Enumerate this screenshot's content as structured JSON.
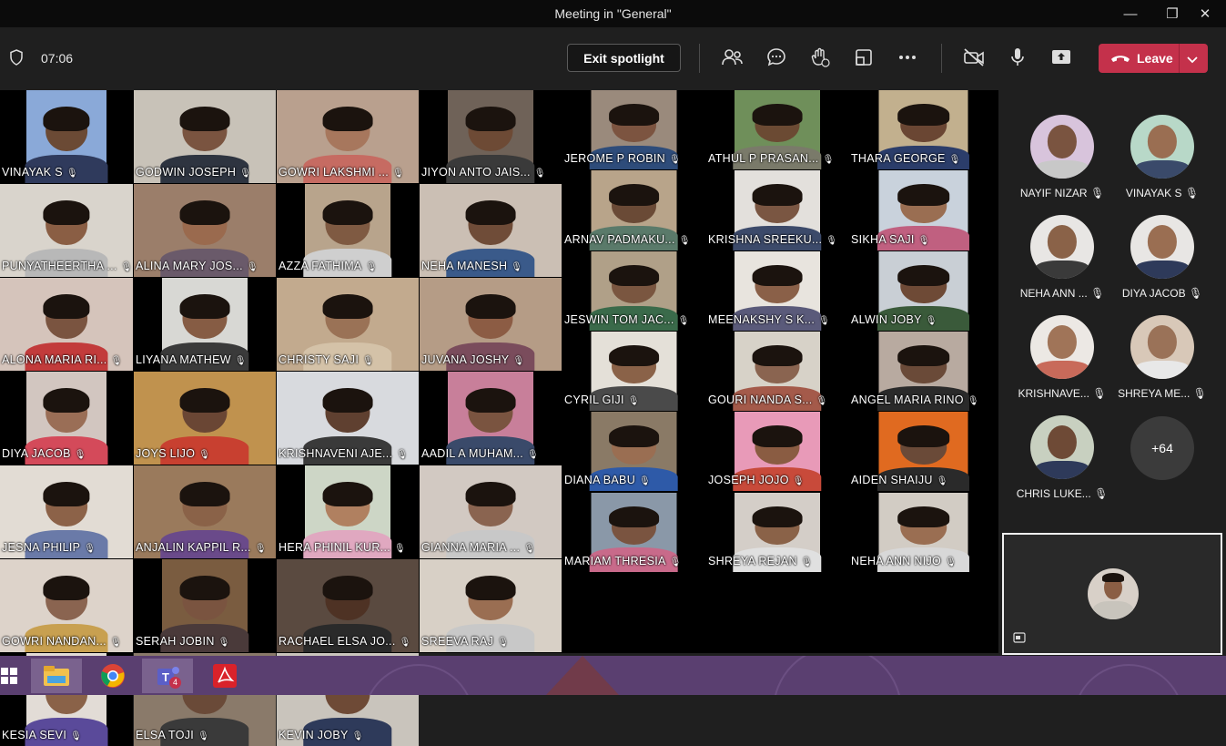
{
  "window": {
    "title": "Meeting in \"General\"",
    "minimize": "—",
    "maximize": "❐",
    "close": "✕"
  },
  "toolbar": {
    "timer": "07:06",
    "exit_spotlight": "Exit spotlight",
    "leave_label": "Leave",
    "icons": [
      "shield-icon",
      "participants-icon",
      "chat-icon",
      "raise-hand-icon",
      "share-tray-icon",
      "more-icon",
      "camera-off-icon",
      "mic-icon",
      "share-screen-icon",
      "phone-icon",
      "chevron-down-icon"
    ]
  },
  "colors": {
    "leave": "#c4314b",
    "bg": "#1f1f1f",
    "titlebar": "#0b0b0b",
    "taskbar": "#5a3f70"
  },
  "grid": {
    "tiles": [
      {
        "name": "VINAYAK  S",
        "bg": "#8aa9d8",
        "skin": "#6b4a35",
        "shirt": "#2f3a5c"
      },
      {
        "name": "GODWIN JOSEPH",
        "bg": "#c8c2b8",
        "skin": "#7a5440",
        "shirt": "#2e3440"
      },
      {
        "name": "GOWRI  LAKSHMI ...",
        "bg": "#b9a08e",
        "skin": "#a7775d",
        "shirt": "#c66b62"
      },
      {
        "name": "JIYON  ANTO JAIS...",
        "bg": "#6f6258",
        "skin": "#6d4a35",
        "shirt": "#3a3a3a"
      },
      {
        "name": "JEROME  P ROBIN",
        "bg": "#9a8a7c",
        "skin": "#7c5440",
        "shirt": "#2e4c7a"
      },
      {
        "name": "ATHUL  P PRASAN...",
        "bg": "#6f8f5a",
        "skin": "#6b4a33",
        "shirt": "#7a7a6a"
      },
      {
        "name": "THARA GEORGE",
        "bg": "#c2b08e",
        "skin": "#6a4633",
        "shirt": "#2b3d6a"
      },
      {
        "name": "PUNYATHEERTHA ...",
        "bg": "#d9d4cc",
        "skin": "#8a5e44",
        "shirt": "#b8b8b8"
      },
      {
        "name": "ALINA  MARY JOS...",
        "bg": "#9b7e6a",
        "skin": "#9a6a4e",
        "shirt": "#6a5a6a"
      },
      {
        "name": "AZZA  FATHIMA",
        "bg": "#b8a48c",
        "skin": "#7f5a42",
        "shirt": "#cfcfcf"
      },
      {
        "name": "NEHA  MANESH",
        "bg": "#cbbfb4",
        "skin": "#6f4c38",
        "shirt": "#3a5a8a"
      },
      {
        "name": "ARNAV PADMAKU...",
        "bg": "#b8a48a",
        "skin": "#6a4a36",
        "shirt": "#5a7a6a"
      },
      {
        "name": "KRISHNA  SREEKU...",
        "bg": "#e3e0dc",
        "skin": "#7a5642",
        "shirt": "#3c4a6a"
      },
      {
        "name": "SIKHA  SAJI",
        "bg": "#c9d2dc",
        "skin": "#9a6e52",
        "shirt": "#c06080"
      },
      {
        "name": "ALONA  MARIA RI...",
        "bg": "#d5c4bb",
        "skin": "#7a5440",
        "shirt": "#c23b3b"
      },
      {
        "name": "LIYANA  MATHEW",
        "bg": "#d8d8d4",
        "skin": "#865c44",
        "shirt": "#3a3a3a"
      },
      {
        "name": "CHRISTY  SAJI",
        "bg": "#c2aa8e",
        "skin": "#9a7256",
        "shirt": "#d4c2a8"
      },
      {
        "name": "JUVANA  JOSHY",
        "bg": "#b59c86",
        "skin": "#8c5c44",
        "shirt": "#7a4c5c"
      },
      {
        "name": "JESWIN  TOM JAC...",
        "bg": "#b0a088",
        "skin": "#7a5640",
        "shirt": "#3a6a4a"
      },
      {
        "name": "MEENAKSHY  S K...",
        "bg": "#e8e4de",
        "skin": "#8a6048",
        "shirt": "#5a5a7a"
      },
      {
        "name": "ALWIN  JOBY",
        "bg": "#c9cfd5",
        "skin": "#6e4a36",
        "shirt": "#3a5a3a"
      },
      {
        "name": "DIYA  JACOB",
        "bg": "#d2c6c0",
        "skin": "#9a6e56",
        "shirt": "#d44a5a"
      },
      {
        "name": "JOYS  LIJO",
        "bg": "#c0924e",
        "skin": "#6a4634",
        "shirt": "#c84030"
      },
      {
        "name": "KRISHNAVENI AJE...",
        "bg": "#d8dade",
        "skin": "#5f4030",
        "shirt": "#3a3a3a"
      },
      {
        "name": "AADIL  A MUHAM...",
        "bg": "#c87f9a",
        "skin": "#7a5440",
        "shirt": "#3a4a6a"
      },
      {
        "name": "CYRIL  GIJI",
        "bg": "#e4e0d8",
        "skin": "#8a6248",
        "shirt": "#4a4a4a"
      },
      {
        "name": "GOURI  NANDA S...",
        "bg": "#d7d2c8",
        "skin": "#8a6450",
        "shirt": "#a45a4a"
      },
      {
        "name": "ANGEL MARIA RINO",
        "bg": "#b8aaa0",
        "skin": "#6a4a38",
        "shirt": "#2a2a2a"
      },
      {
        "name": "JESNA  PHILIP",
        "bg": "#e2dcd4",
        "skin": "#8c6248",
        "shirt": "#6a7aa8"
      },
      {
        "name": "ANJALIN KAPPIL R...",
        "bg": "#9a7a5c",
        "skin": "#8a6248",
        "shirt": "#6a4a8a"
      },
      {
        "name": "HERA  PHINIL KUR...",
        "bg": "#cdd6c6",
        "skin": "#b08060",
        "shirt": "#e0a8c0"
      },
      {
        "name": "GIANNA  MARIA ...",
        "bg": "#d2c9c2",
        "skin": "#8a6450",
        "shirt": "#c8c8c8"
      },
      {
        "name": "DIANA  BABU",
        "bg": "#8a7a66",
        "skin": "#9a6e52",
        "shirt": "#2e5aa8"
      },
      {
        "name": "JOSEPH  JOJO",
        "bg": "#e89ab8",
        "skin": "#8a5c42",
        "shirt": "#c84a3a"
      },
      {
        "name": "AIDEN  SHAIJU",
        "bg": "#e06a20",
        "skin": "#6a4a38",
        "shirt": "#2a2a2a"
      },
      {
        "name": "GOWRI NANDAN...",
        "bg": "#ddd3ca",
        "skin": "#8a6450",
        "shirt": "#c8a050"
      },
      {
        "name": "SERAH  JOBIN",
        "bg": "#7a5c40",
        "skin": "#7a5440",
        "shirt": "#4a3a3a"
      },
      {
        "name": "RACHAEL  ELSA JO...",
        "bg": "#5a4a40",
        "skin": "#4e3224",
        "shirt": "#2a2a2a"
      },
      {
        "name": "SREEVA  RAJ",
        "bg": "#d8d0c6",
        "skin": "#9a6e52",
        "shirt": "#c8c8c8"
      },
      {
        "name": "MARIAM THRESIA",
        "bg": "#8a98a8",
        "skin": "#7a5440",
        "shirt": "#c86a8a"
      },
      {
        "name": "SHREYA  REJAN",
        "bg": "#d4cec8",
        "skin": "#8a6248",
        "shirt": "#e0e0e0"
      },
      {
        "name": "NEHA ANN NIJO",
        "bg": "#d2ccc4",
        "skin": "#9a6e52",
        "shirt": "#d8d8d8"
      },
      {
        "name": "KESIA  SEVI",
        "bg": "#e2dcd6",
        "skin": "#8a6248",
        "shirt": "#5a4a9a"
      },
      {
        "name": "ELSA  TOJI",
        "bg": "#8a7a6a",
        "skin": "#6a4a38",
        "shirt": "#3a3a3a"
      },
      {
        "name": "KEVIN  JOBY",
        "bg": "#c9c4bc",
        "skin": "#6e4a36",
        "shirt": "#2e3a5a"
      }
    ]
  },
  "panel": {
    "participants": [
      {
        "name": "NAYIF NIZAR",
        "bg": "#d8c4dc",
        "skin": "#7a5440",
        "shirt": "#c8c8c8"
      },
      {
        "name": "VINAYAK S",
        "bg": "#b8d8c8",
        "skin": "#9a6e52",
        "shirt": "#3a4a6a"
      },
      {
        "name": "NEHA ANN ...",
        "bg": "#e8e6e4",
        "skin": "#8a6248",
        "shirt": "#3a3a3a"
      },
      {
        "name": "DIYA JACOB",
        "bg": "#e8e6e4",
        "skin": "#9a6e52",
        "shirt": "#2e3a5a"
      },
      {
        "name": "KRISHNAVE...",
        "bg": "#ece8e4",
        "skin": "#a07458",
        "shirt": "#c86a5a"
      },
      {
        "name": "SHREYA ME...",
        "bg": "#d8c8b8",
        "skin": "#9a7258",
        "shirt": "#e8e8e8"
      },
      {
        "name": "CHRIS LUKE...",
        "bg": "#c8d0c0",
        "skin": "#6e4a36",
        "shirt": "#2e3a5a"
      }
    ],
    "more_count": "+64"
  },
  "taskbar": {
    "icons": [
      "windows-start-icon",
      "file-explorer-icon",
      "chrome-icon",
      "teams-icon",
      "acrobat-icon"
    ],
    "teams_badge": "4"
  }
}
